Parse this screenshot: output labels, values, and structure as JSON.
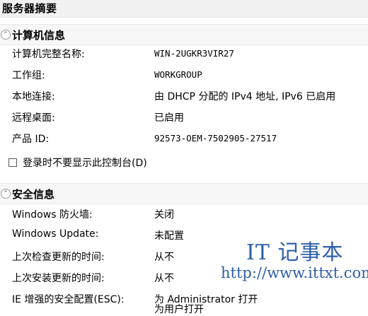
{
  "panel_title": "服务器摘要",
  "computer_section": {
    "title": "计算机信息",
    "rows": [
      {
        "label": "计算机完整名称:",
        "value": "WIN-2UGKR3VIR27"
      },
      {
        "label": "工作组:",
        "value": "WORKGROUP"
      },
      {
        "label": "本地连接:",
        "value": "由 DHCP 分配的 IPv4 地址, IPv6 已启用"
      },
      {
        "label": "远程桌面:",
        "value": "已启用"
      },
      {
        "label": "产品 ID:",
        "value": "92573-OEM-7502905-27517"
      }
    ],
    "checkbox_label": "登录时不要显示此控制台(D)",
    "checkbox_checked": false
  },
  "security_section": {
    "title": "安全信息",
    "rows": [
      {
        "label": "Windows 防火墙:",
        "value": "关闭"
      },
      {
        "label": "Windows Update:",
        "value": "未配置"
      },
      {
        "label": "上次检查更新的时间:",
        "value": "从不"
      },
      {
        "label": "上次安装更新的时间:",
        "value": "从不"
      },
      {
        "label": "IE 增强的安全配置(ESC):",
        "value": "为 Administrator 打开"
      }
    ],
    "cut_off_text": "为用户打开"
  },
  "watermark": {
    "brand": "IT 记事本",
    "url": "http://www.ittxt.com"
  },
  "colors": {
    "watermark": "#2e5fa8",
    "section_header_bg": "#f7f7f7"
  }
}
